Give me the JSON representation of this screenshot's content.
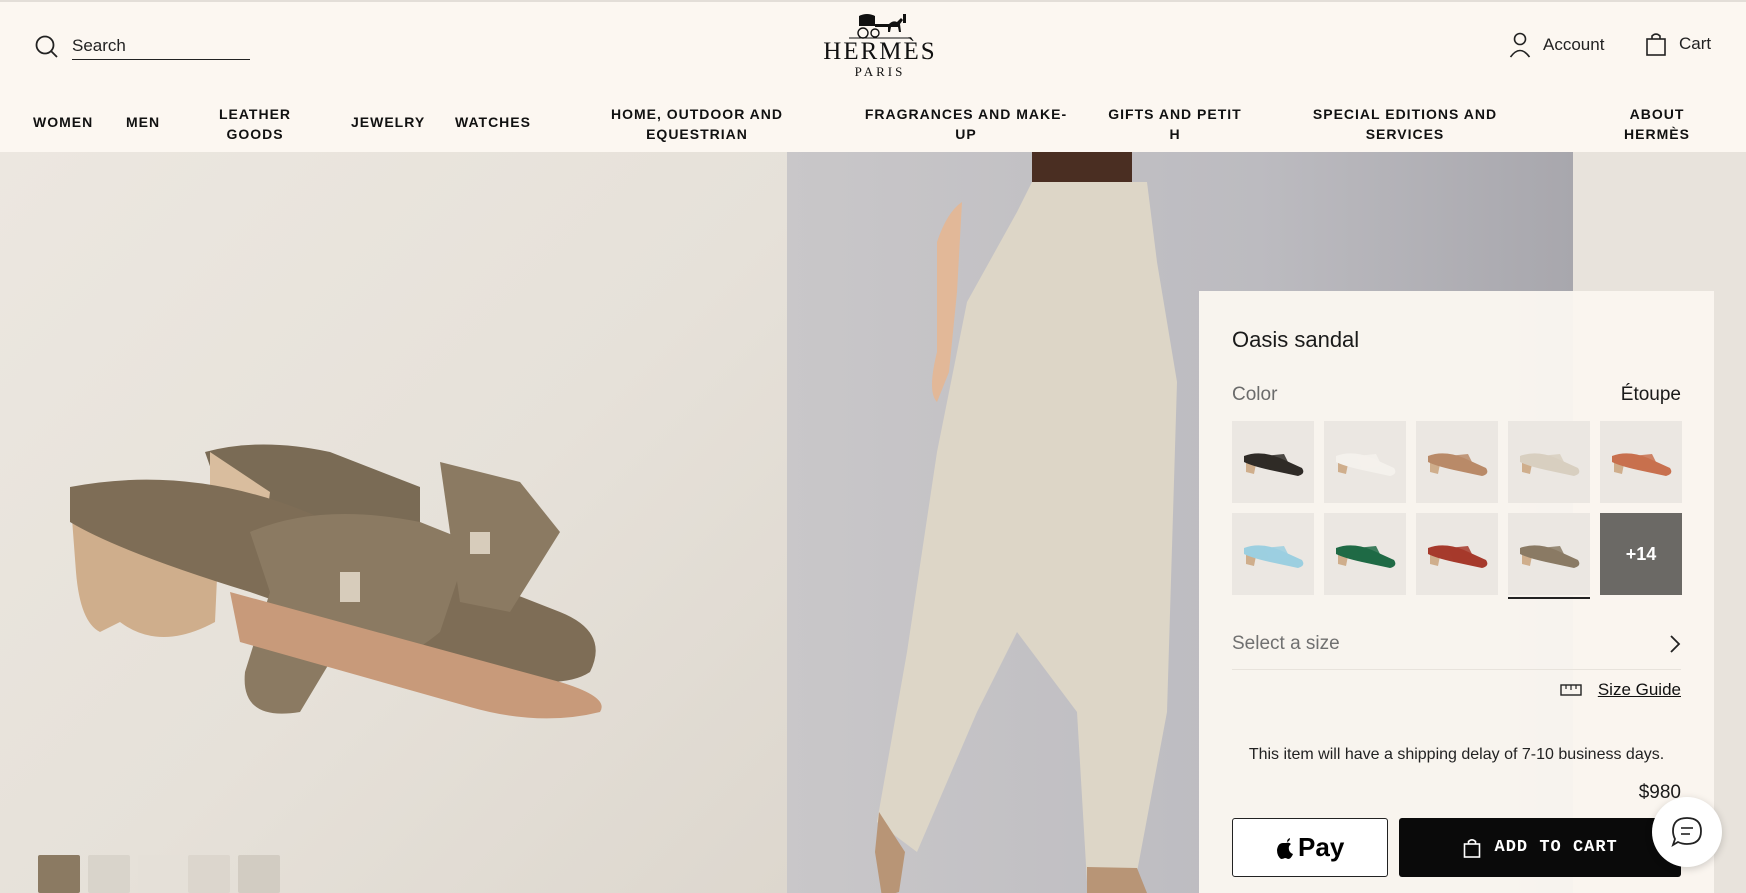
{
  "header": {
    "search_placeholder": "Search",
    "logo_word": "HERMÈS",
    "logo_city": "PARIS",
    "account_label": "Account",
    "cart_label": "Cart"
  },
  "nav": [
    {
      "label": "WOMEN"
    },
    {
      "label": "MEN"
    },
    {
      "label": "LEATHER\nGOODS"
    },
    {
      "label": "JEWELRY"
    },
    {
      "label": "WATCHES"
    },
    {
      "label": "HOME, OUTDOOR AND\nEQUESTRIAN"
    },
    {
      "label": "FRAGRANCES AND MAKE-\nUP"
    },
    {
      "label": "GIFTS AND PETIT\nH"
    },
    {
      "label": "SPECIAL EDITIONS AND\nSERVICES"
    },
    {
      "label": "ABOUT\nHERMÈS"
    }
  ],
  "product": {
    "name": "Oasis sandal",
    "color_label": "Color",
    "color_value": "Étoupe",
    "swatches": [
      {
        "color": "#2f2b27",
        "selected": false
      },
      {
        "color": "#f4f1ec",
        "selected": false
      },
      {
        "color": "#b98a68",
        "selected": false
      },
      {
        "color": "#d8cfc0",
        "selected": false
      },
      {
        "color": "#c8704e",
        "selected": false
      },
      {
        "color": "#9ccfe0",
        "selected": false
      },
      {
        "color": "#1f6a45",
        "selected": false
      },
      {
        "color": "#a63a2c",
        "selected": false
      },
      {
        "color": "#8a7a64",
        "selected": true
      },
      {
        "color": "#6b6965",
        "selected": false,
        "more_label": "+14"
      }
    ],
    "size_label": "Select a size",
    "size_guide_label": "Size Guide",
    "shipping_delay": "This item will have a shipping delay of 7-10 business days.",
    "price": "$980",
    "apple_pay_label": "Pay",
    "add_to_cart_label": "ADD TO CART"
  },
  "colors": {
    "background": "#fcf7f1",
    "button_dark": "#0a0a0a",
    "sandal_etoupe": "#8b7a62"
  }
}
